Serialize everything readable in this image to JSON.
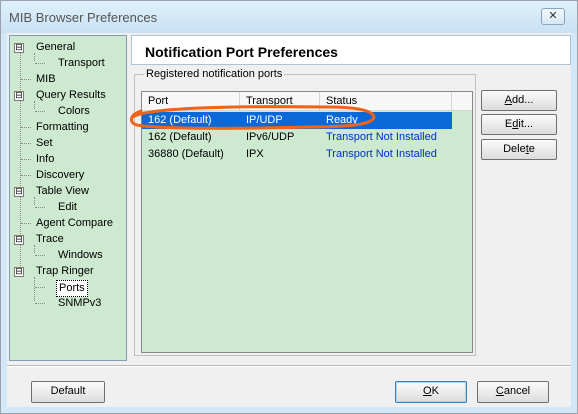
{
  "window": {
    "title": "MIB Browser Preferences",
    "close_glyph": "✕"
  },
  "tree": {
    "items": [
      {
        "label": "General",
        "level": 0,
        "expander": "⊟"
      },
      {
        "label": "Transport",
        "level": 1
      },
      {
        "label": "MIB",
        "level": 0
      },
      {
        "label": "Query Results",
        "level": 0,
        "expander": "⊟"
      },
      {
        "label": "Colors",
        "level": 1
      },
      {
        "label": "Formatting",
        "level": 0
      },
      {
        "label": "Set",
        "level": 0
      },
      {
        "label": "Info",
        "level": 0
      },
      {
        "label": "Discovery",
        "level": 0
      },
      {
        "label": "Table View",
        "level": 0,
        "expander": "⊟"
      },
      {
        "label": "Edit",
        "level": 1
      },
      {
        "label": "Agent Compare",
        "level": 0
      },
      {
        "label": "Trace",
        "level": 0,
        "expander": "⊟"
      },
      {
        "label": "Windows",
        "level": 1
      },
      {
        "label": "Trap Ringer",
        "level": 0,
        "expander": "⊟"
      },
      {
        "label": "Ports",
        "level": 1,
        "selected": true
      },
      {
        "label": "SNMPv3",
        "level": 1
      }
    ]
  },
  "panel": {
    "title": "Notification Port Preferences",
    "group_label": "Registered notification ports",
    "columns": [
      "Port",
      "Transport",
      "Status"
    ],
    "rows": [
      {
        "port": "162 (Default)",
        "transport": "IP/UDP",
        "status": "Ready",
        "selected": true
      },
      {
        "port": "162 (Default)",
        "transport": "IPv6/UDP",
        "status": "Transport Not Installed"
      },
      {
        "port": "36880 (Default)",
        "transport": "IPX",
        "status": "Transport Not Installed"
      }
    ]
  },
  "buttons": {
    "add": {
      "pre": "",
      "key": "A",
      "post": "dd..."
    },
    "edit": {
      "pre": "E",
      "key": "d",
      "post": "it..."
    },
    "delete": {
      "pre": "Dele",
      "key": "t",
      "post": "e"
    },
    "default": "Default",
    "ok": {
      "pre": "",
      "key": "O",
      "post": "K"
    },
    "cancel": {
      "pre": "",
      "key": "C",
      "post": "ancel"
    }
  },
  "colors": {
    "tree_bg": "#cde9cf",
    "selection": "#0a68d8",
    "annotation": "#f06418",
    "status_link": "#0030c8"
  }
}
